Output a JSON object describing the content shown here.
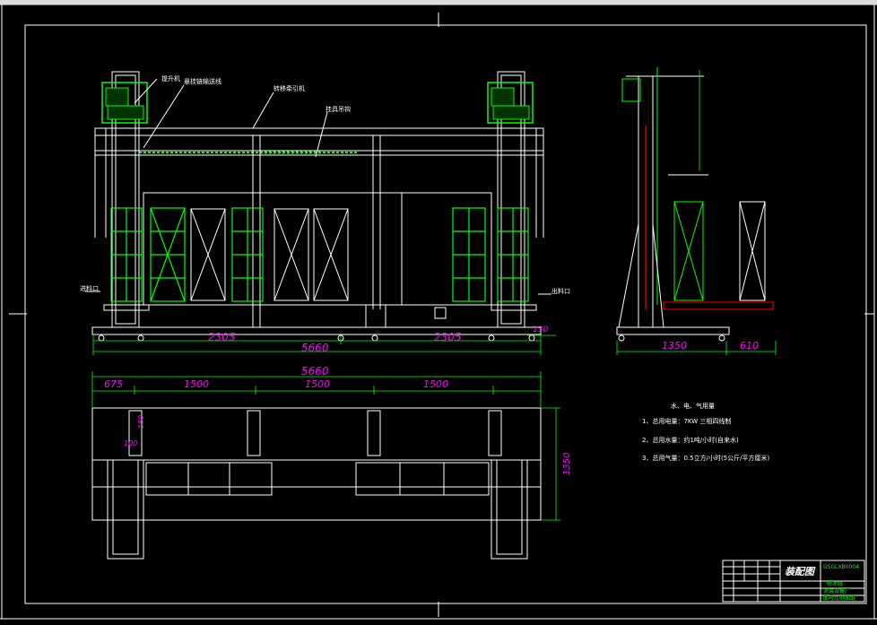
{
  "callouts": {
    "elevator": "提升机",
    "chain_conveyor": "悬挂链输送线",
    "transfer": "转移牵引机",
    "hanger": "挂具吊钩",
    "inlet": "进料口",
    "outlet": "出料口"
  },
  "front_view_dims": {
    "left_span": "2305",
    "right_span": "2305",
    "total": "5660",
    "end": "130"
  },
  "side_view_dims": {
    "base": "1350",
    "frame": "610"
  },
  "plan_view_dims": {
    "total": "5660",
    "seg1": "675",
    "seg2": "1500",
    "seg3": "1500",
    "seg4": "1500",
    "depth": "1350",
    "d1": "150",
    "d2": "100"
  },
  "notes": {
    "heading": "水、电、气用量",
    "n1": "1、总用电量：7KW 三相四线制",
    "n2": "2、总用水量：约1吨/小时(自来水)",
    "n3": "3、总用气量：0.5立方/小时(5公斤/平方厘米)"
  },
  "title_block": {
    "drawing_name": "装配图",
    "code": "GSGLXB0004",
    "row1": "喷涂线",
    "row2": "涂装设备厂",
    "row3": "图号比例图纸"
  },
  "colors": {
    "background": "#000000",
    "lines": "#ffffff",
    "equipment": "#00ff00",
    "dimensions": "#ff00ff",
    "red": "#ff0000"
  }
}
